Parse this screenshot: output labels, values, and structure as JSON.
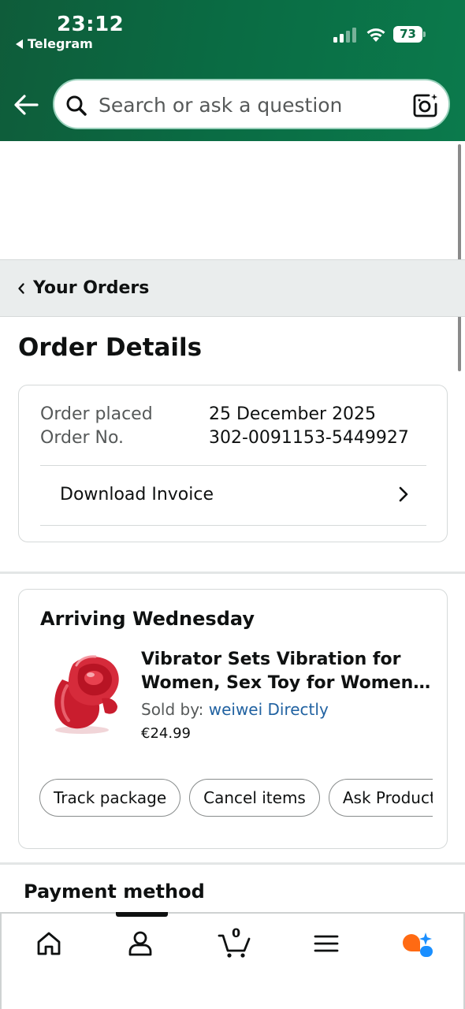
{
  "status_bar": {
    "time": "23:12",
    "back_app": "Telegram",
    "battery": "73"
  },
  "search": {
    "placeholder": "Search or ask a question"
  },
  "orders_bar": {
    "label": "Your Orders"
  },
  "page": {
    "title": "Order Details"
  },
  "order_info": {
    "placed_label": "Order placed",
    "placed_value": "25 December 2025",
    "number_label": "Order No.",
    "number_value": "302-0091153-5449927",
    "invoice_label": "Download Invoice"
  },
  "shipment": {
    "arriving": "Arriving Wednesday",
    "product_title": "Vibrator Sets Vibration for Women, Sex Toy for Women, Clitoris Stimulator",
    "sold_by_label": "Sold by: ",
    "seller": "weiwei Directly",
    "price": "€24.99",
    "buttons": [
      "Track package",
      "Cancel items",
      "Ask Product Question"
    ]
  },
  "payment": {
    "title": "Payment method"
  },
  "bottom_nav": {
    "cart_count": "0",
    "items": [
      "home-icon",
      "account-icon",
      "cart-icon",
      "menu-icon",
      "rufus-ai-icon"
    ]
  },
  "colors": {
    "header_green": "#0a6b43",
    "link_blue": "#2162a1",
    "product_red": "#d62b3b",
    "ai_orange": "#ff6a13",
    "ai_blue": "#1a8fff"
  }
}
